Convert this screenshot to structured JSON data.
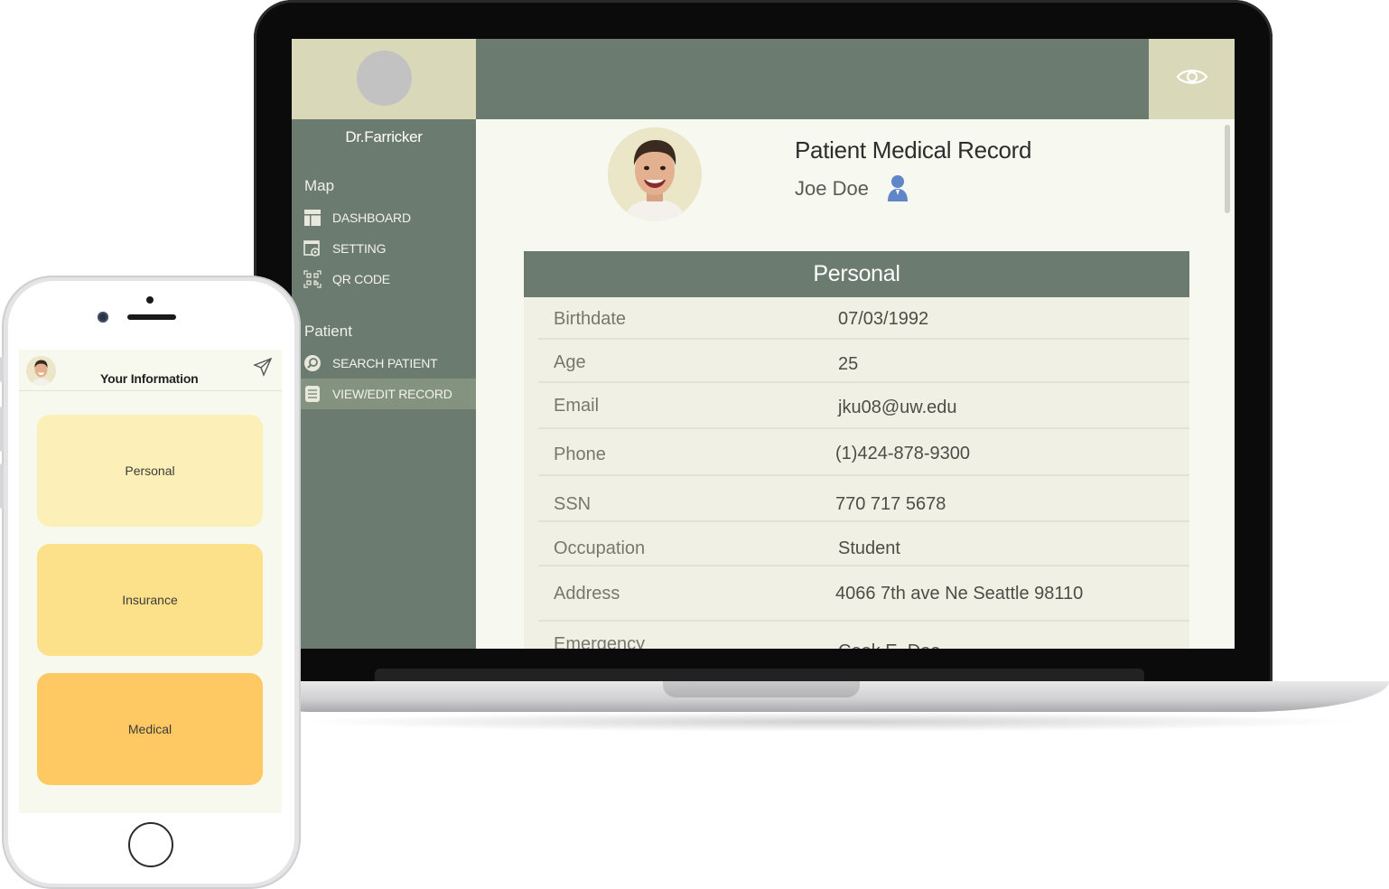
{
  "sidebar": {
    "doctor_name": "Dr.Farricker",
    "sections": [
      {
        "title": "Map",
        "items": [
          {
            "label": "DASHBOARD",
            "icon": "dashboard-icon"
          },
          {
            "label": "SETTING",
            "icon": "settings-icon"
          },
          {
            "label": "QR CODE",
            "icon": "qr-code-icon"
          }
        ]
      },
      {
        "title": "Patient",
        "items": [
          {
            "label": "SEARCH PATIENT",
            "icon": "search-icon"
          },
          {
            "label": "VIEW/EDIT RECORD",
            "icon": "record-icon",
            "active": true
          }
        ]
      }
    ]
  },
  "header": {
    "title": "Patient Medical Record",
    "patient_name": "Joe Doe"
  },
  "panel": {
    "title": "Personal",
    "rows": [
      {
        "label": "Birthdate",
        "value": "07/03/1992"
      },
      {
        "label": "Age",
        "value": "25"
      },
      {
        "label": "Email",
        "value": "jku08@uw.edu"
      },
      {
        "label": "Phone",
        "value": "(1)424-878-9300"
      },
      {
        "label": "SSN",
        "value": "770 717 5678"
      },
      {
        "label": "Occupation",
        "value": "Student"
      },
      {
        "label": "Address",
        "value": "4066 7th ave Ne Seattle 98110"
      },
      {
        "label": "Emergency",
        "value": "Cook E. Doe"
      }
    ]
  },
  "phone": {
    "title": "Your Information",
    "cards": [
      {
        "label": "Personal",
        "color": "#fcf0b8"
      },
      {
        "label": "Insurance",
        "color": "#fde08a"
      },
      {
        "label": "Medical",
        "color": "#fec962"
      }
    ]
  },
  "colors": {
    "sidebar": "#6b7b6f",
    "accent_beige": "#d9d8b8",
    "background": "#f7f8ef",
    "active_nav": "#84937f"
  }
}
